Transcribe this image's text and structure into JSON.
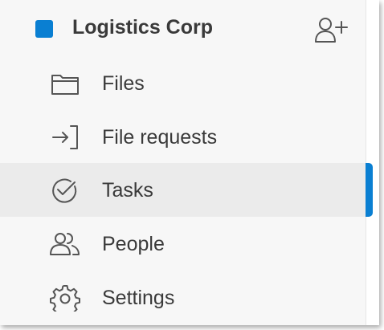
{
  "team": {
    "name": "Logistics Corp",
    "color": "#0a7fd2",
    "add_member_icon": "add-user-icon"
  },
  "nav": {
    "items": [
      {
        "label": "Files",
        "icon": "folder-icon",
        "active": false
      },
      {
        "label": "File requests",
        "icon": "file-request-icon",
        "active": false
      },
      {
        "label": "Tasks",
        "icon": "check-circle-icon",
        "active": true
      },
      {
        "label": "People",
        "icon": "people-icon",
        "active": false
      },
      {
        "label": "Settings",
        "icon": "gear-icon",
        "active": false
      }
    ]
  },
  "colors": {
    "accent": "#0a7fd2",
    "text": "#3a3a3a",
    "icon": "#555555",
    "sidebar_bg": "#f7f7f7",
    "active_bg": "#ebebeb"
  }
}
